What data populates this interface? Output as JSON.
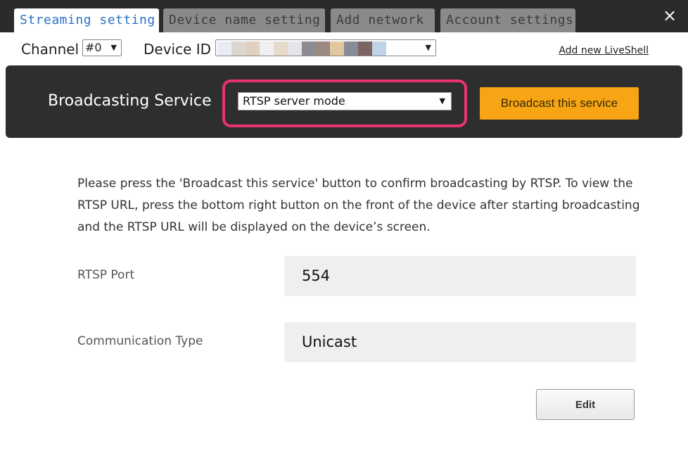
{
  "tabs": [
    {
      "label": "Streaming setting",
      "active": true
    },
    {
      "label": "Device name setting",
      "active": false
    },
    {
      "label": "Add network",
      "active": false
    },
    {
      "label": "Account settings",
      "active": false
    }
  ],
  "close_icon": "×",
  "channel": {
    "label": "Channel",
    "value": "#0"
  },
  "device_id": {
    "label": "Device ID",
    "swatches": [
      "#e9edf3",
      "#ddd6cf",
      "#e1cfbf",
      "#efeff1",
      "#e6dacb",
      "#e4e5e8",
      "#8c8d92",
      "#9a8a7f",
      "#e2c79e",
      "#8a8b99",
      "#7c6463",
      "#bfd2e8"
    ]
  },
  "add_link": "Add new LiveShell",
  "service": {
    "label": "Broadcasting Service",
    "selected": "RTSP server mode",
    "broadcast_button": "Broadcast this service"
  },
  "notice": "Please press the 'Broadcast this service' button to confirm broadcasting by RTSP. To view the RTSP URL, press the bottom right button on the front of the device after starting broadcasting and the RTSP URL will be displayed on the device’s screen.",
  "fields": [
    {
      "label": "RTSP Port",
      "value": "554"
    },
    {
      "label": "Communication Type",
      "value": "Unicast"
    }
  ],
  "edit_button": "Edit",
  "colors": {
    "accent_tab_text": "#2a72c6",
    "highlight": "#e8336d",
    "broadcast_button": "#f7a514",
    "dark_band": "#2e2e2e"
  }
}
